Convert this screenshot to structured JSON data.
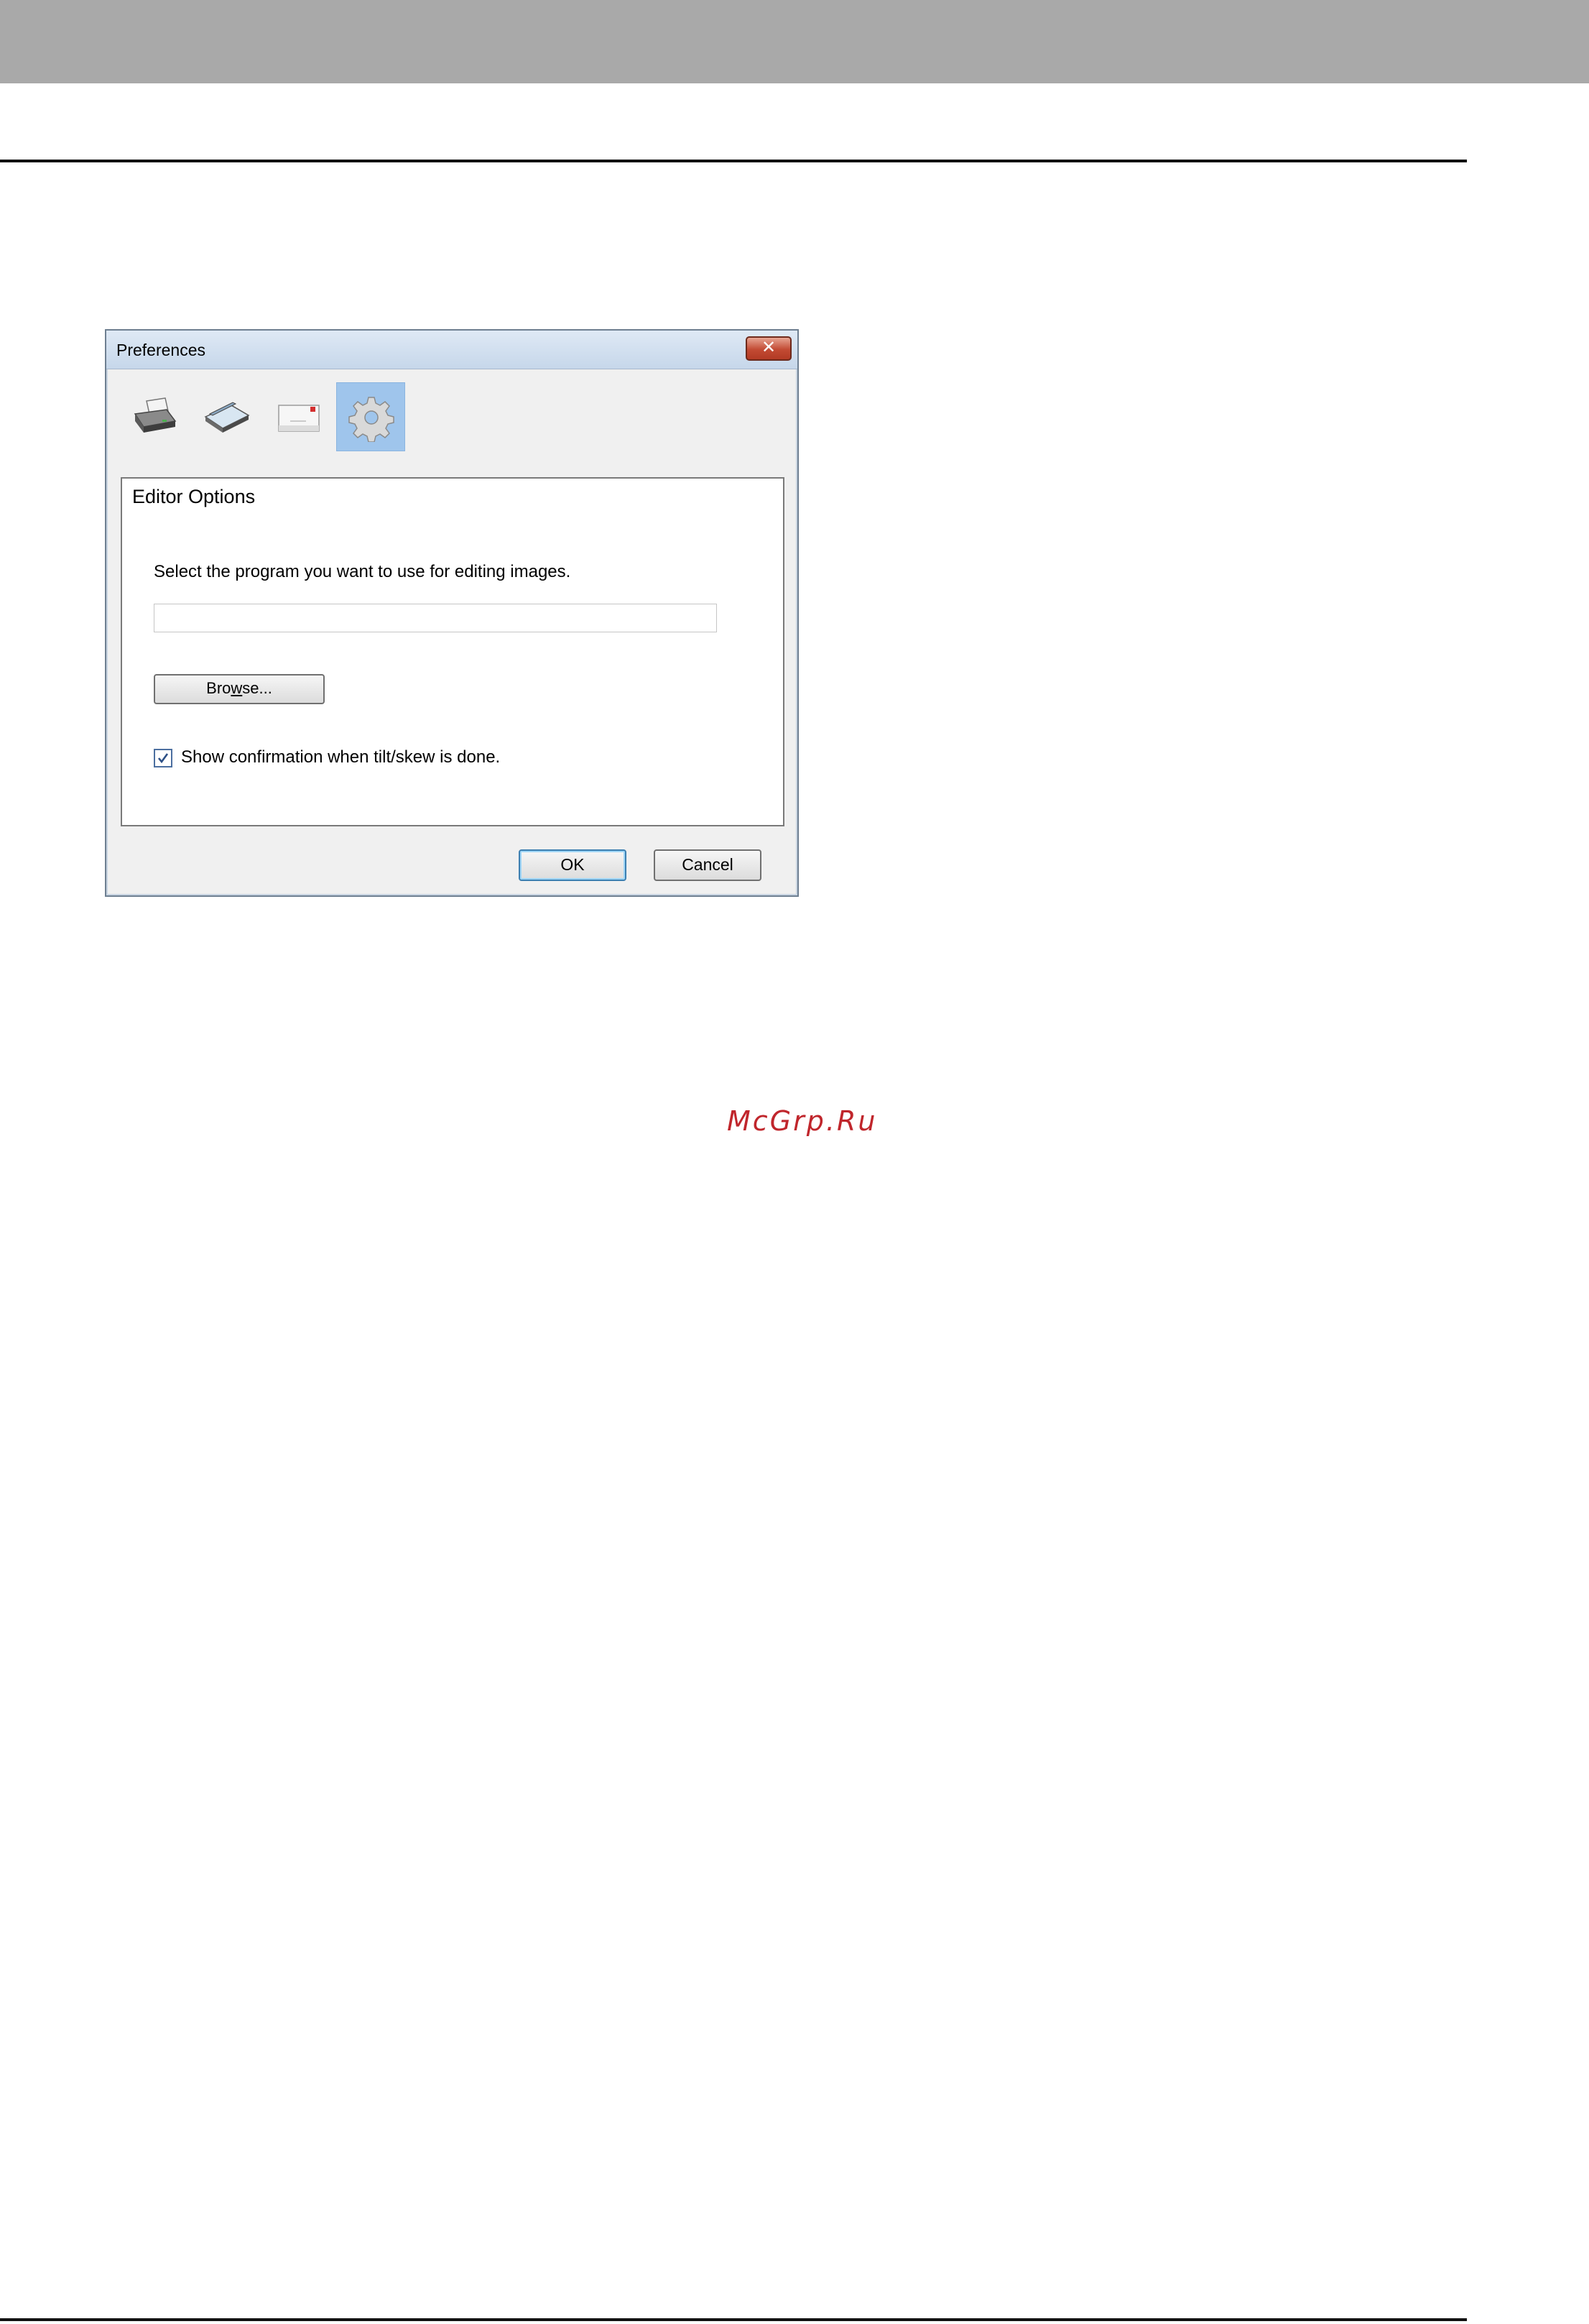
{
  "dialog": {
    "title": "Preferences",
    "close_glyph": "✕",
    "toolbar": [
      {
        "icon": "printer-icon",
        "selected": false
      },
      {
        "icon": "scanner-icon",
        "selected": false
      },
      {
        "icon": "envelope-icon",
        "selected": false
      },
      {
        "icon": "gear-icon",
        "selected": true
      }
    ],
    "group_title": "Editor Options",
    "hint": "Select the program you want to use for editing images.",
    "path_value": "",
    "browse_pre": "Bro",
    "browse_mnemonic": "w",
    "browse_post": "se...",
    "checkbox_label": "Show confirmation when tilt/skew is done.",
    "checkbox_checked": true,
    "ok_label": "OK",
    "cancel_label": "Cancel"
  },
  "watermark": "McGrp.Ru",
  "colors": {
    "top_band": "#a9a9a9",
    "selected_tool": "#9fc5ec",
    "close_button": "#c24a33",
    "watermark": "#c0262c"
  }
}
